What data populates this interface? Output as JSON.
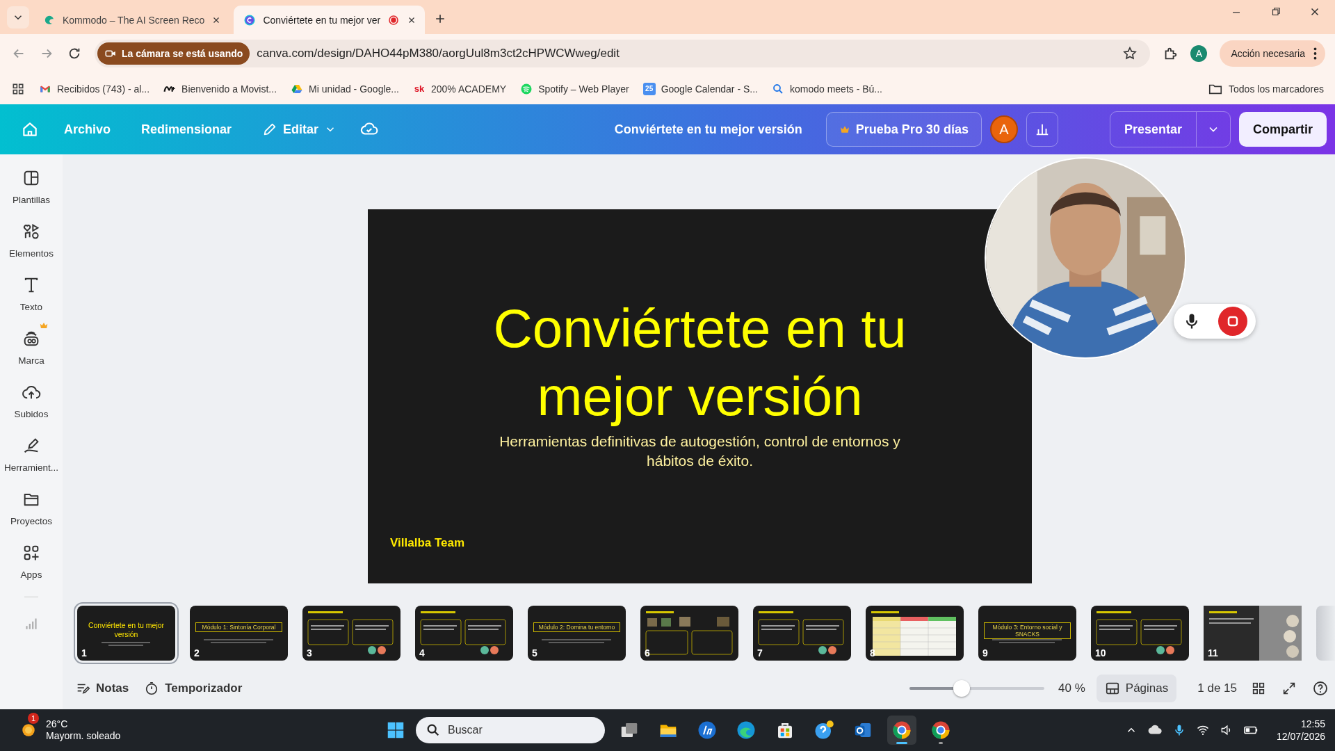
{
  "browser": {
    "tabs": [
      {
        "title": "Kommodo – The AI Screen Reco",
        "kind": "kommodo",
        "selected": false,
        "recording": false
      },
      {
        "title": "Conviértete en tu mejor ver",
        "kind": "canva",
        "selected": true,
        "recording": true
      }
    ],
    "camera_badge": "La cámara se está usando",
    "url": "canva.com/design/DAHO44pM380/aorgUul8m3ct2cHPWCWweg/edit",
    "bookmarked": false,
    "profile_initial": "A",
    "action_button": "Acción necesaria",
    "bookmarks": [
      {
        "label": "Recibidos (743) - al...",
        "kind": "gmail"
      },
      {
        "label": "Bienvenido a Movist...",
        "kind": "movistar"
      },
      {
        "label": "Mi unidad - Google...",
        "kind": "drive"
      },
      {
        "label": "200% ACADEMY",
        "kind": "badge",
        "icon_text": "sk"
      },
      {
        "label": "Spotify – Web Player",
        "kind": "spotify"
      },
      {
        "label": "Google Calendar - S...",
        "kind": "calendar",
        "icon_text": "25"
      },
      {
        "label": "komodo meets - Bú...",
        "kind": "search"
      }
    ],
    "all_bookmarks": "Todos los marcadores"
  },
  "editor": {
    "menu": [
      {
        "label": "Archivo",
        "kind": "plain"
      },
      {
        "label": "Redimensionar",
        "kind": "plain"
      },
      {
        "label": "Editar",
        "kind": "dropdown"
      }
    ],
    "document_title": "Conviértete en tu mejor versión",
    "pro_trial": "Prueba Pro 30 días",
    "avatar_initial": "A",
    "present": "Presentar",
    "share": "Compartir",
    "sidebar": [
      {
        "label": "Plantillas",
        "kind": "templates",
        "premium": false
      },
      {
        "label": "Elementos",
        "kind": "elements",
        "premium": false
      },
      {
        "label": "Texto",
        "kind": "text",
        "premium": false
      },
      {
        "label": "Marca",
        "kind": "brand",
        "premium": true
      },
      {
        "label": "Subidos",
        "kind": "uploads",
        "premium": false
      },
      {
        "label": "Herramient...",
        "kind": "tools",
        "premium": false
      },
      {
        "label": "Proyectos",
        "kind": "projects",
        "premium": false
      },
      {
        "label": "Apps",
        "kind": "apps",
        "premium": false
      }
    ],
    "slide": {
      "title": "Conviértete en tu mejor versión",
      "subtitle": "Herramientas definitivas de autogestión, control de entornos y hábitos de éxito.",
      "footer": "Villalba Team"
    },
    "thumbnails": [
      {
        "number": "1",
        "kind": "title",
        "title": "Conviértete en tu mejor versión",
        "selected": true
      },
      {
        "number": "2",
        "kind": "module",
        "title": "Módulo 1: Sintonía Corporal",
        "selected": false
      },
      {
        "number": "3",
        "kind": "columns",
        "selected": false
      },
      {
        "number": "4",
        "kind": "columns",
        "selected": false
      },
      {
        "number": "5",
        "kind": "module",
        "title": "Módulo 2: Domina tu entorno",
        "selected": false
      },
      {
        "number": "6",
        "kind": "photos",
        "selected": false
      },
      {
        "number": "7",
        "kind": "columns",
        "selected": false
      },
      {
        "number": "8",
        "kind": "table",
        "selected": false
      },
      {
        "number": "9",
        "kind": "module",
        "title": "Módulo 3: Entorno social y SNACKS",
        "selected": false
      },
      {
        "number": "10",
        "kind": "columns",
        "selected": false
      },
      {
        "number": "11",
        "kind": "gallery",
        "selected": false
      }
    ],
    "footer": {
      "notes": "Notas",
      "timer": "Temporizador",
      "zoom": {
        "level": 0.37,
        "reading": "40 %"
      },
      "pages": "Páginas",
      "page_count": "1 de 15"
    }
  },
  "taskbar": {
    "weather": {
      "temperature": "26°C",
      "condition": "Mayorm. soleado",
      "badge": "1"
    },
    "search_placeholder": "Buscar",
    "apps": [
      {
        "kind": "taskview",
        "running": false,
        "selected": false
      },
      {
        "kind": "explorer",
        "running": false,
        "selected": false
      },
      {
        "kind": "hp",
        "running": false,
        "selected": false
      },
      {
        "kind": "edge",
        "running": false,
        "selected": false
      },
      {
        "kind": "store",
        "running": false,
        "selected": false
      },
      {
        "kind": "help",
        "running": false,
        "selected": false
      },
      {
        "kind": "outlook",
        "running": false,
        "selected": false
      },
      {
        "kind": "chrome",
        "running": true,
        "selected": true
      },
      {
        "kind": "chrome",
        "running": true,
        "selected": false
      }
    ],
    "time": "12:55",
    "date": "12/07/2026"
  }
}
